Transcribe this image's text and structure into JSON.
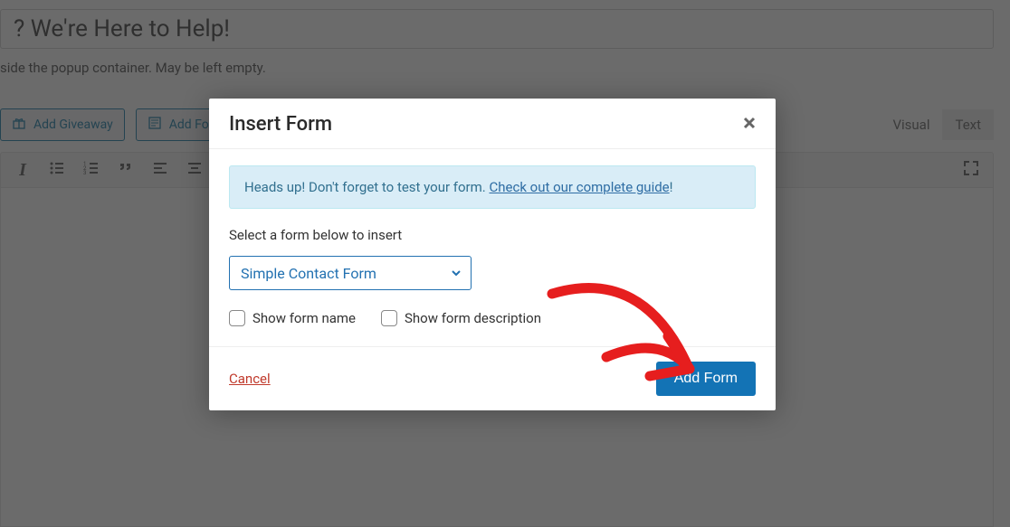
{
  "title_input": "? We're Here to Help!",
  "helper_text": "side the popup container. May be left empty.",
  "toolbar": {
    "add_giveaway": "Add Giveaway",
    "add_form": "Add Form"
  },
  "tabs": {
    "visual": "Visual",
    "text": "Text"
  },
  "modal": {
    "title": "Insert Form",
    "alert_heads_up": "Heads up!",
    "alert_text": " Don't forget to test your form. ",
    "alert_link": "Check out our complete guide",
    "alert_punct": "!",
    "select_label": "Select a form below to insert",
    "selected_option": "Simple Contact Form",
    "checkbox_name": "Show form name",
    "checkbox_desc": "Show form description",
    "cancel": "Cancel",
    "add_button": "Add Form"
  }
}
